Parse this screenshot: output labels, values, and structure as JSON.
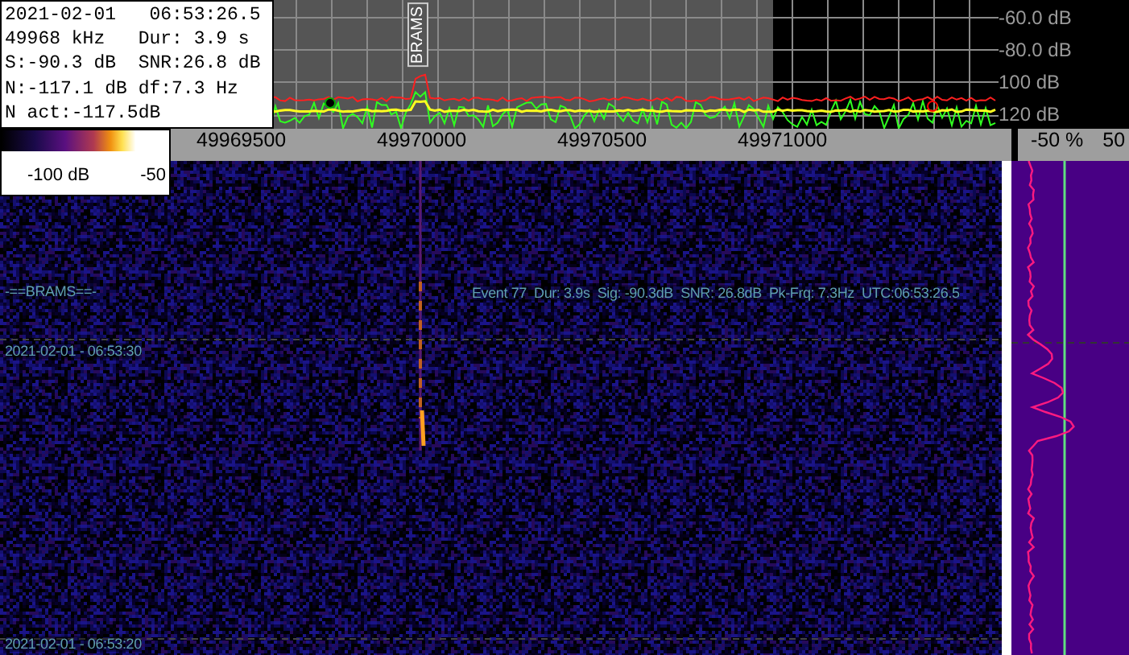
{
  "info_box": {
    "lines": [
      "2021-02-01   06:53:26.5",
      "49968 kHz   Dur: 3.9 s",
      "S:-90.3 dB  SNR:26.8 dB",
      "N:-117.1 dB df:7.3 Hz",
      "N act:-117.5dB"
    ]
  },
  "spectrum": {
    "marker": "BRAMS",
    "db_labels": [
      "-60.0 dB",
      "-80.0 dB",
      "100 dB",
      "120 dB"
    ]
  },
  "colorbar": {
    "labels": [
      "-100 dB",
      "-50"
    ]
  },
  "frequency_ruler": {
    "labels": [
      "49969500",
      "49970000",
      "49970500",
      "49971000"
    ]
  },
  "percent_ruler": {
    "labels": [
      "-50 %",
      "50"
    ]
  },
  "waterfall": {
    "station": "-==BRAMS==-",
    "event": "Event 77  Dur: 3.9s  Sig: -90.3dB  SNR: 26.8dB  Pk-Frq: 7.3Hz  UTC:06:53:26.5",
    "timestamps": [
      "2021-02-01 - 06:53:30",
      "2021-02-01 - 06:53:20"
    ]
  }
}
